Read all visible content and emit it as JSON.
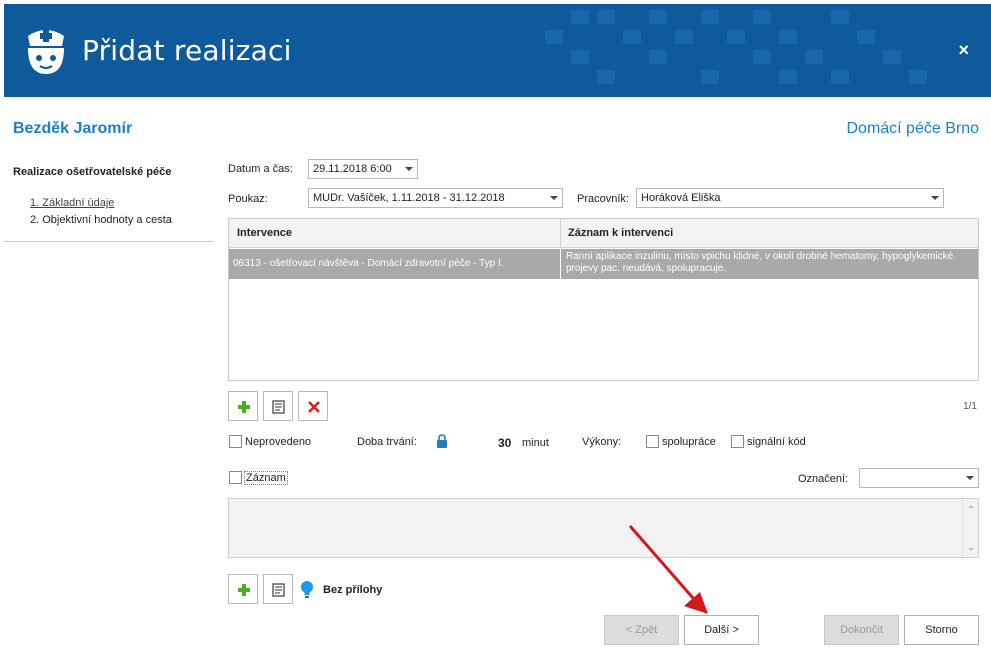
{
  "header": {
    "title": "Přidat realizaci",
    "close_label": "×"
  },
  "patient_name": "Bezděk Jaromír",
  "organization": "Domácí péče Brno",
  "left_panel": {
    "heading": "Realizace ošetřovatelské péče",
    "steps": [
      {
        "label": "1. Základní údaje"
      },
      {
        "label": "2. Objektivní hodnoty a cesta"
      }
    ]
  },
  "form": {
    "datetime_label": "Datum a čas:",
    "datetime_value": "29.11.2018 6:00",
    "poukaz_label": "Poukaz:",
    "poukaz_value": "MUDr. Vašíček, 1.11.2018 - 31.12.2018",
    "pracovnik_label": "Pracovník:",
    "pracovnik_value": "Horáková Eliška"
  },
  "grid": {
    "columns": [
      "Intervence",
      "Záznam k intervenci"
    ],
    "rows": [
      {
        "intervence": "06313 - ošetřovací návštěva - Domácí zdravotní péče - Typ I.",
        "zaznam": "Ranní aplikace  inzulinu,  místo vpichu klidné, v okolí drobné hematomy, hypoglykemické projevy pac. neudává, spolupracuje."
      }
    ],
    "pager": "1/1"
  },
  "options": {
    "neprovedeno_label": "Neprovedeno",
    "doba_label": "Doba trvání:",
    "doba_value": "30",
    "doba_unit": "minut",
    "vykony_label": "Výkony:",
    "spoluprace_label": "spolupráce",
    "signalni_label": "signální kód",
    "zaznam_label": "Záznam",
    "oznaceni_label": "Označení:",
    "oznaceni_value": ""
  },
  "attachments": {
    "label": "Bez přílohy"
  },
  "buttons": {
    "back": "< Zpět",
    "next": "Další >",
    "finish": "Dokončit",
    "cancel": "Storno"
  },
  "colors": {
    "header_bg": "#0e5a9a",
    "accent": "#1f7fc4",
    "selected_row": "#a9a9a9",
    "annotation_arrow": "#d11a1a"
  }
}
